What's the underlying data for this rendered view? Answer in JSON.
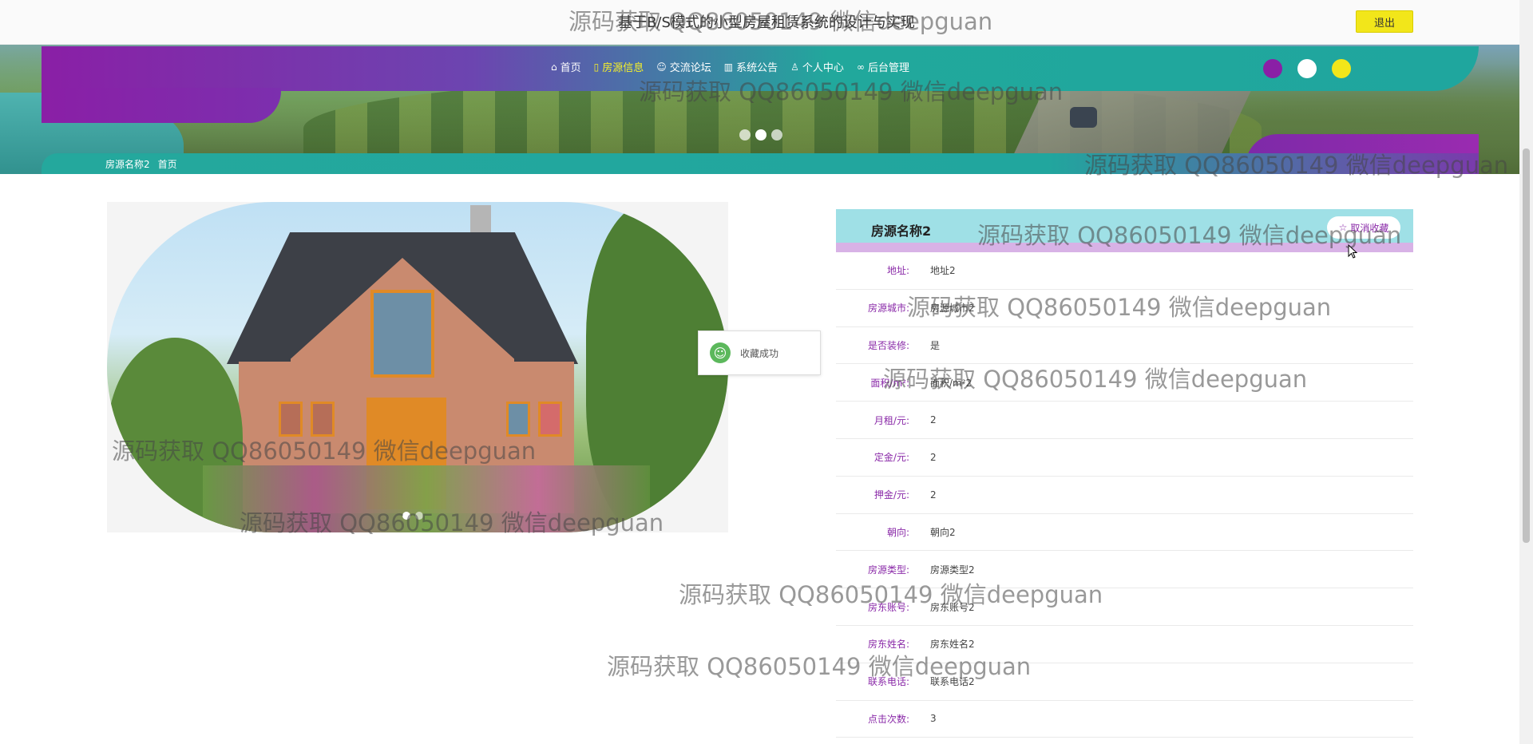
{
  "header": {
    "site_title": "基于B/S模式的小型房屋租赁系统的设计与实现",
    "logout_label": "退出"
  },
  "nav": {
    "items": [
      {
        "label": "首页",
        "icon": "home-icon",
        "active": false
      },
      {
        "label": "房源信息",
        "icon": "bookmark-icon",
        "active": true
      },
      {
        "label": "交流论坛",
        "icon": "chat-icon",
        "active": false
      },
      {
        "label": "系统公告",
        "icon": "book-icon",
        "active": false
      },
      {
        "label": "个人中心",
        "icon": "user-icon",
        "active": false
      },
      {
        "label": "后台管理",
        "icon": "link-icon",
        "active": false
      }
    ],
    "theme_colors": [
      "#8a1fa6",
      "#ffffff",
      "#f2e61a"
    ]
  },
  "breadcrumb": {
    "items": [
      "房源名称2",
      "首页"
    ]
  },
  "toast": {
    "text": "收藏成功"
  },
  "detail": {
    "title": "房源名称2",
    "favorite_label": "取消收藏",
    "rows": [
      {
        "label": "地址:",
        "value": "地址2"
      },
      {
        "label": "房源城市:",
        "value": "房源城市2"
      },
      {
        "label": "是否装修:",
        "value": "是"
      },
      {
        "label": "面积/m²:",
        "value": "面积/m²2"
      },
      {
        "label": "月租/元:",
        "value": "2"
      },
      {
        "label": "定金/元:",
        "value": "2"
      },
      {
        "label": "押金/元:",
        "value": "2"
      },
      {
        "label": "朝向:",
        "value": "朝向2"
      },
      {
        "label": "房源类型:",
        "value": "房源类型2"
      },
      {
        "label": "房东账号:",
        "value": "房东账号2"
      },
      {
        "label": "房东姓名:",
        "value": "房东姓名2"
      },
      {
        "label": "联系电话:",
        "value": "联系电话2"
      },
      {
        "label": "点击次数:",
        "value": "3"
      }
    ]
  },
  "watermark": {
    "text": "源码获取 QQ86050149 微信deepguan"
  },
  "colors": {
    "accent_purple": "#8a1fa6",
    "accent_teal": "#21a69e",
    "accent_yellow": "#f2e61a",
    "label_color": "#8a2aa8"
  }
}
